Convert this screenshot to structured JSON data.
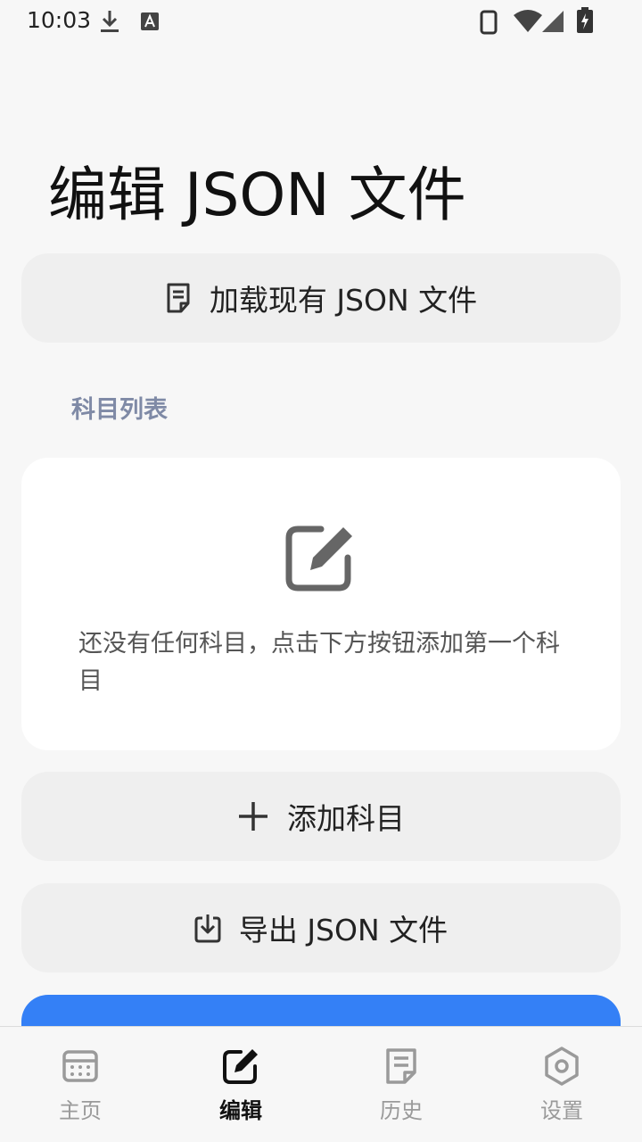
{
  "status_bar": {
    "time": "10:03",
    "left_icons": [
      "download-icon",
      "accessibility-icon"
    ],
    "right_icons": [
      "phone-icon",
      "wifi-icon",
      "signal-icon",
      "battery-charging-icon"
    ]
  },
  "page": {
    "title": "编辑 JSON 文件"
  },
  "load_button": {
    "label": "加载现有 JSON 文件",
    "icon": "document-icon"
  },
  "section": {
    "label": "科目列表"
  },
  "empty_state": {
    "icon": "edit-icon",
    "message": "还没有任何科目，点击下方按钮添加第一个科目"
  },
  "add_button": {
    "label": "添加科目",
    "icon": "plus-icon"
  },
  "export_button": {
    "label": "导出 JSON 文件",
    "icon": "download-icon"
  },
  "nav": {
    "items": [
      {
        "label": "主页",
        "icon": "calendar-icon",
        "active": false
      },
      {
        "label": "编辑",
        "icon": "edit-icon",
        "active": true
      },
      {
        "label": "历史",
        "icon": "history-icon",
        "active": false
      },
      {
        "label": "设置",
        "icon": "settings-icon",
        "active": false
      }
    ]
  },
  "colors": {
    "background": "#f7f7f7",
    "card": "#ffffff",
    "pill": "#efefef",
    "primary": "#3480f6",
    "section_label": "#7f8aa6",
    "nav_inactive": "#9a9a9a",
    "nav_active": "#111111"
  }
}
